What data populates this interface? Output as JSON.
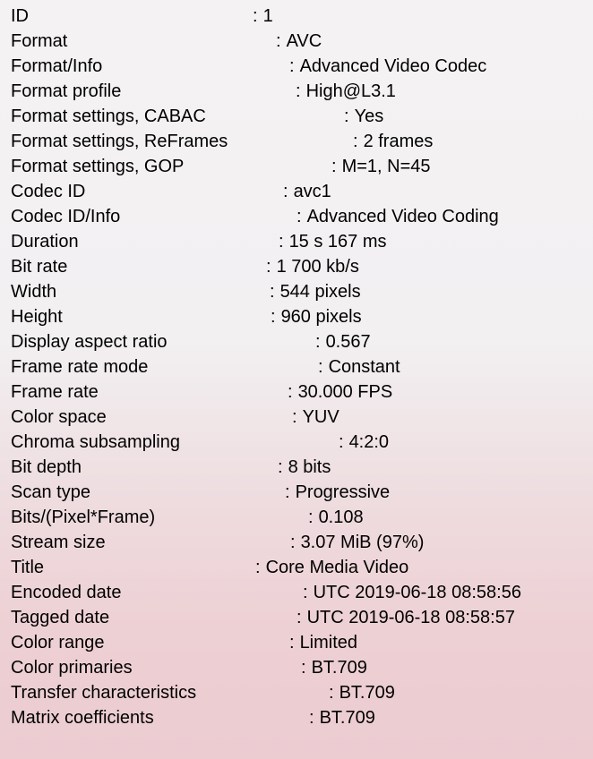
{
  "rows": [
    {
      "label": "ID",
      "value": "1"
    },
    {
      "label": "Format",
      "value": "AVC"
    },
    {
      "label": "Format/Info",
      "value": "Advanced Video Codec"
    },
    {
      "label": "Format profile",
      "value": "High@L3.1"
    },
    {
      "label": "Format settings, CABAC",
      "value": "Yes"
    },
    {
      "label": "Format settings, ReFrames",
      "value": "2 frames"
    },
    {
      "label": "Format settings, GOP",
      "value": "M=1, N=45"
    },
    {
      "label": "Codec ID",
      "value": "avc1"
    },
    {
      "label": "Codec ID/Info",
      "value": "Advanced Video Coding"
    },
    {
      "label": "Duration",
      "value": "15 s 167 ms"
    },
    {
      "label": "Bit rate",
      "value": "1 700 kb/s"
    },
    {
      "label": "Width",
      "value": "544 pixels"
    },
    {
      "label": "Height",
      "value": "960 pixels"
    },
    {
      "label": "Display aspect ratio",
      "value": "0.567"
    },
    {
      "label": "Frame rate mode",
      "value": "Constant"
    },
    {
      "label": "Frame rate",
      "value": "30.000 FPS"
    },
    {
      "label": "Color space",
      "value": "YUV"
    },
    {
      "label": "Chroma subsampling",
      "value": "4:2:0"
    },
    {
      "label": "Bit depth",
      "value": "8 bits"
    },
    {
      "label": "Scan type",
      "value": "Progressive"
    },
    {
      "label": "Bits/(Pixel*Frame)",
      "value": "0.108"
    },
    {
      "label": "Stream size",
      "value": "3.07 MiB (97%)"
    },
    {
      "label": "Title",
      "value": "Core Media Video"
    },
    {
      "label": "Encoded date",
      "value": "UTC 2019-06-18 08:58:56"
    },
    {
      "label": "Tagged date",
      "value": "UTC 2019-06-18 08:58:57"
    },
    {
      "label": "Color range",
      "value": "Limited"
    },
    {
      "label": "Color primaries",
      "value": "BT.709"
    },
    {
      "label": "Transfer characteristics",
      "value": "BT.709"
    },
    {
      "label": "Matrix coefficients",
      "value": "BT.709"
    }
  ]
}
